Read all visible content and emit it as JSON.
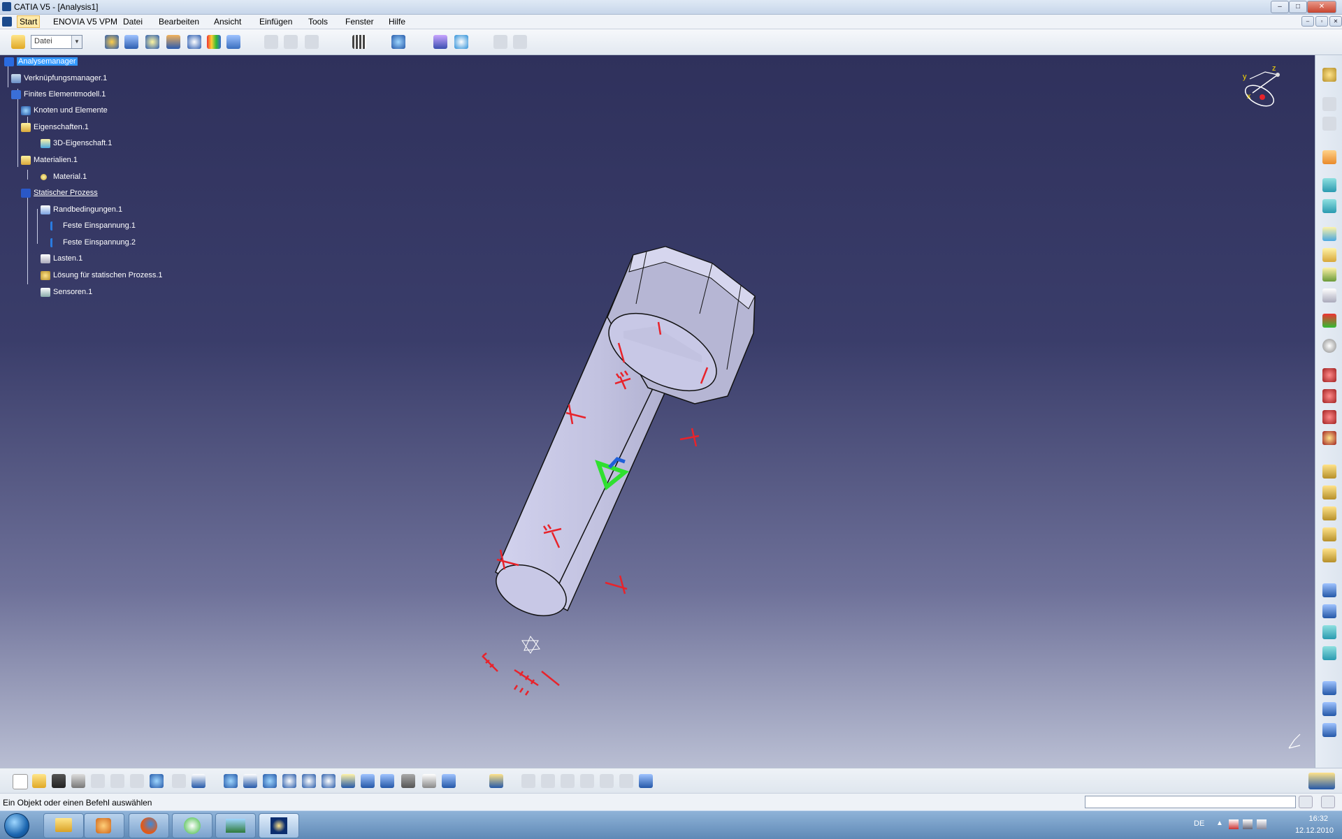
{
  "window": {
    "title": "CATIA V5 - [Analysis1]"
  },
  "menu": {
    "items": [
      "Start",
      "ENOVIA V5 VPM",
      "Datei",
      "Bearbeiten",
      "Ansicht",
      "Einfügen",
      "Tools",
      "Fenster",
      "Hilfe"
    ]
  },
  "toolbar": {
    "workbench_select": "Datei"
  },
  "tree": {
    "nodes": [
      {
        "label": "Analysemanager",
        "selected": true
      },
      {
        "label": "Verknüpfungsmanager.1"
      },
      {
        "label": "Finites Elementmodell.1"
      },
      {
        "label": "Knoten und Elemente"
      },
      {
        "label": "Eigenschaften.1"
      },
      {
        "label": "3D-Eigenschaft.1"
      },
      {
        "label": "Materialien.1"
      },
      {
        "label": "Material.1"
      },
      {
        "label": "Statischer Prozess",
        "underline": true
      },
      {
        "label": "Randbedingungen.1"
      },
      {
        "label": "Feste Einspannung.1"
      },
      {
        "label": "Feste Einspannung.2"
      },
      {
        "label": "Lasten.1"
      },
      {
        "label": "Lösung für statischen Prozess.1"
      },
      {
        "label": "Sensoren.1"
      }
    ]
  },
  "compass": {
    "x": "x",
    "y": "y",
    "z": "z"
  },
  "status": {
    "text": "Ein Objekt oder einen Befehl auswählen"
  },
  "taskbar": {
    "lang": "DE",
    "time": "16:32",
    "date": "12.12.2010"
  },
  "colors": {
    "viewport_top": "#2f315c",
    "viewport_bottom": "#b9bed3",
    "constraint": "#e8232b",
    "part": "#c4c4e2",
    "selection": "#3399ff"
  },
  "icons": [
    "open-icon",
    "save-icon",
    "print-icon",
    "undo-icon",
    "redo-icon",
    "fly-icon",
    "fit-all-icon",
    "pan-icon",
    "rotate-icon",
    "zoom-in-icon",
    "zoom-out-icon",
    "normal-view-icon",
    "catia-logo-icon",
    "compass-icon"
  ]
}
